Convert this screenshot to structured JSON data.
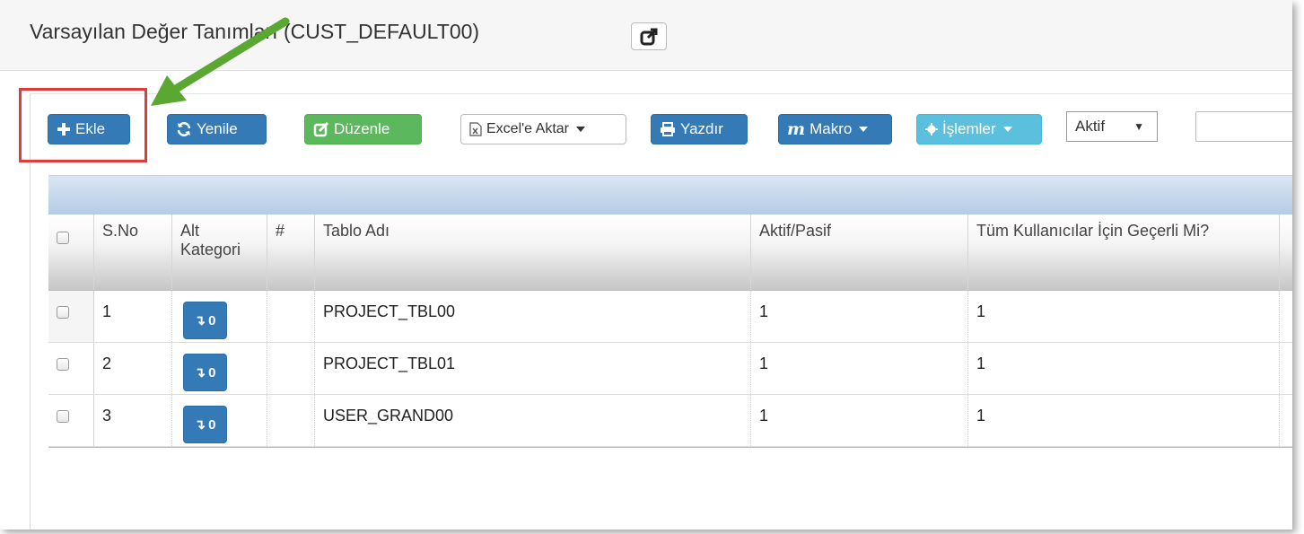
{
  "header": {
    "title": "Varsayılan Değer Tanımları (CUST_DEFAULT00)",
    "external_icon": "external-link-icon"
  },
  "toolbar": {
    "add_label": "Ekle",
    "refresh_label": "Yenile",
    "edit_label": "Düzenle",
    "excel_label": "Excel'e Aktar",
    "print_label": "Yazdır",
    "macro_label": "Makro",
    "operations_label": "İşlemler",
    "status_select": "Aktif",
    "search_value": ""
  },
  "table": {
    "columns": [
      "S.No",
      "Alt Kategori",
      "#",
      "Tablo Adı",
      "Aktif/Pasif",
      "Tüm Kullanıcılar İçin Geçerli Mi?"
    ],
    "col_alt_line1": "Alt",
    "col_alt_line2": "Kategori",
    "rows": [
      {
        "sno": "1",
        "sub_count": "0",
        "table_name": "PROJECT_TBL00",
        "active": "1",
        "all_users": "1"
      },
      {
        "sno": "2",
        "sub_count": "0",
        "table_name": "PROJECT_TBL01",
        "active": "1",
        "all_users": "1"
      },
      {
        "sno": "3",
        "sub_count": "0",
        "table_name": "USER_GRAND00",
        "active": "1",
        "all_users": "1"
      }
    ]
  },
  "colors": {
    "primary": "#337ab7",
    "success": "#5cb85c",
    "info": "#5bc0de",
    "highlight": "#e33b3b",
    "arrow": "#5aa832"
  }
}
